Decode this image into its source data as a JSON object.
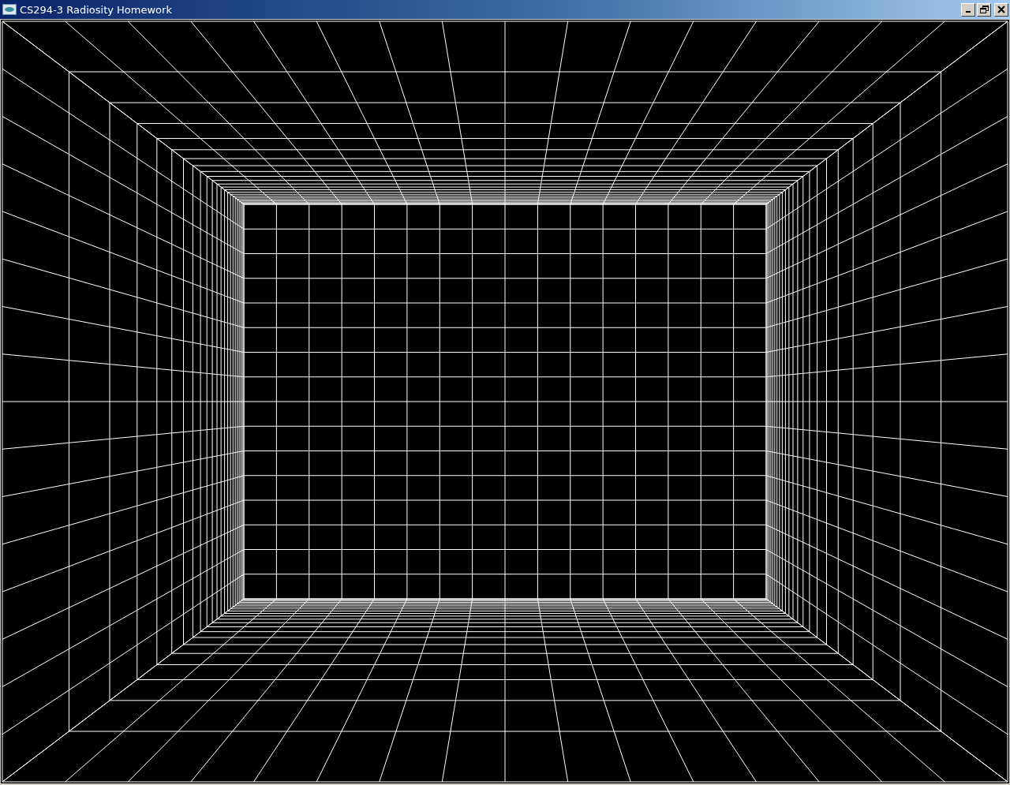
{
  "window": {
    "title": "CS294-3 Radiosity Homework"
  }
}
